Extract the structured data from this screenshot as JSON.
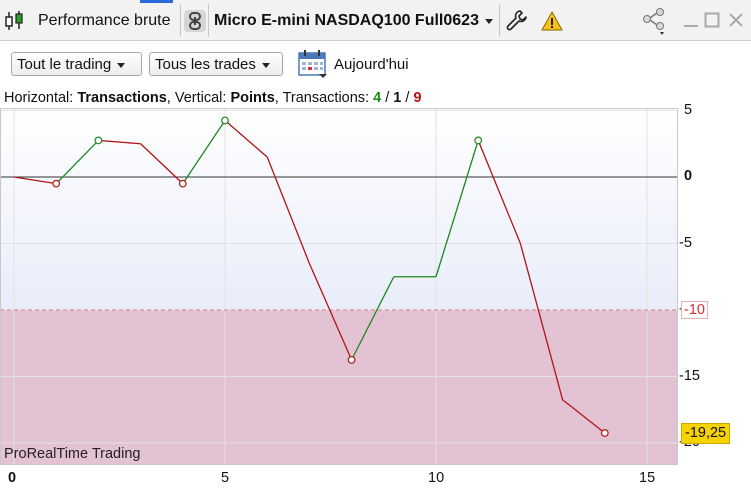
{
  "topbar": {
    "title": "Performance brute",
    "instrument": "Micro E-mini NASDAQ100 Full0623",
    "icons": [
      "candlestick-icon",
      "link-icon",
      "wrench-icon",
      "warning-icon",
      "share-icon",
      "minimize-icon",
      "maximize-icon",
      "close-icon"
    ]
  },
  "toolbar": {
    "trading_filter": "Tout le trading",
    "trades_filter": "Tous les trades",
    "date_label": "Aujourd'hui"
  },
  "chart_header": {
    "horizontal_label": "Horizontal:",
    "horizontal_value": "Transactions",
    "vertical_label": ", Vertical:",
    "vertical_value": "Points",
    "transactions_label": ", Transactions:",
    "winners": "4",
    "sep1": "/",
    "neutral": "1",
    "sep2": "/",
    "losers": "9"
  },
  "watermark": "ProRealTime Trading",
  "colors": {
    "gain": "#1a8a1a",
    "loss": "#b01515",
    "threshold_band": "#e3c3d3",
    "upper_band": "#f2f4fc",
    "current_value_bg": "#f5d200",
    "threshold_label": "#d03030"
  },
  "chart_data": {
    "type": "line",
    "xlabel": "",
    "ylabel": "",
    "xlim": [
      0,
      16
    ],
    "ylim": [
      -20.8,
      6
    ],
    "x_ticks": [
      "0",
      "5",
      "10",
      "15"
    ],
    "y_ticks": [
      "5",
      "0",
      "-5",
      "-10",
      "-15",
      "-20"
    ],
    "threshold": "-10",
    "current_value": "-19,25",
    "x": [
      0,
      1,
      2,
      3,
      4,
      5,
      6,
      7,
      8,
      9,
      10,
      11,
      12,
      13,
      14
    ],
    "y": [
      0,
      -0.5,
      2.75,
      2.5,
      -0.5,
      4.25,
      1.5,
      -6.5,
      -13.75,
      -7.5,
      -7.5,
      2.75,
      -5.0,
      -16.75,
      -19.25
    ]
  }
}
